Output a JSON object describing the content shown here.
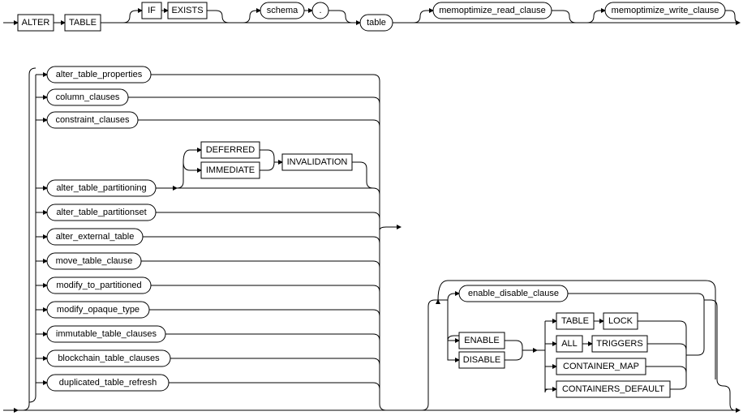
{
  "top": {
    "alter": "ALTER",
    "table": "TABLE",
    "if": "IF",
    "exists": "EXISTS",
    "schema": "schema",
    "dot": ".",
    "table_nt": "table",
    "memoptimize_read": "memoptimize_read_clause",
    "memoptimize_write": "memoptimize_write_clause"
  },
  "clauses": {
    "alter_table_properties": "alter_table_properties",
    "column_clauses": "column_clauses",
    "constraint_clauses": "constraint_clauses",
    "alter_table_partitioning": "alter_table_partitioning",
    "deferred": "DEFERRED",
    "immediate": "IMMEDIATE",
    "invalidation": "INVALIDATION",
    "alter_table_partitionset": "alter_table_partitionset",
    "alter_external_table": "alter_external_table",
    "move_table_clause": "move_table_clause",
    "modify_to_partitioned": "modify_to_partitioned",
    "modify_opaque_type": "modify_opaque_type",
    "immutable_table_clauses": "immutable_table_clauses",
    "blockchain_table_clauses": "blockchain_table_clauses",
    "duplicated_table_refresh": "duplicated_table_refresh"
  },
  "right": {
    "enable_disable_clause": "enable_disable_clause",
    "enable": "ENABLE",
    "disable": "DISABLE",
    "table": "TABLE",
    "lock": "LOCK",
    "all": "ALL",
    "triggers": "TRIGGERS",
    "container_map": "CONTAINER_MAP",
    "containers_default": "CONTAINERS_DEFAULT"
  }
}
